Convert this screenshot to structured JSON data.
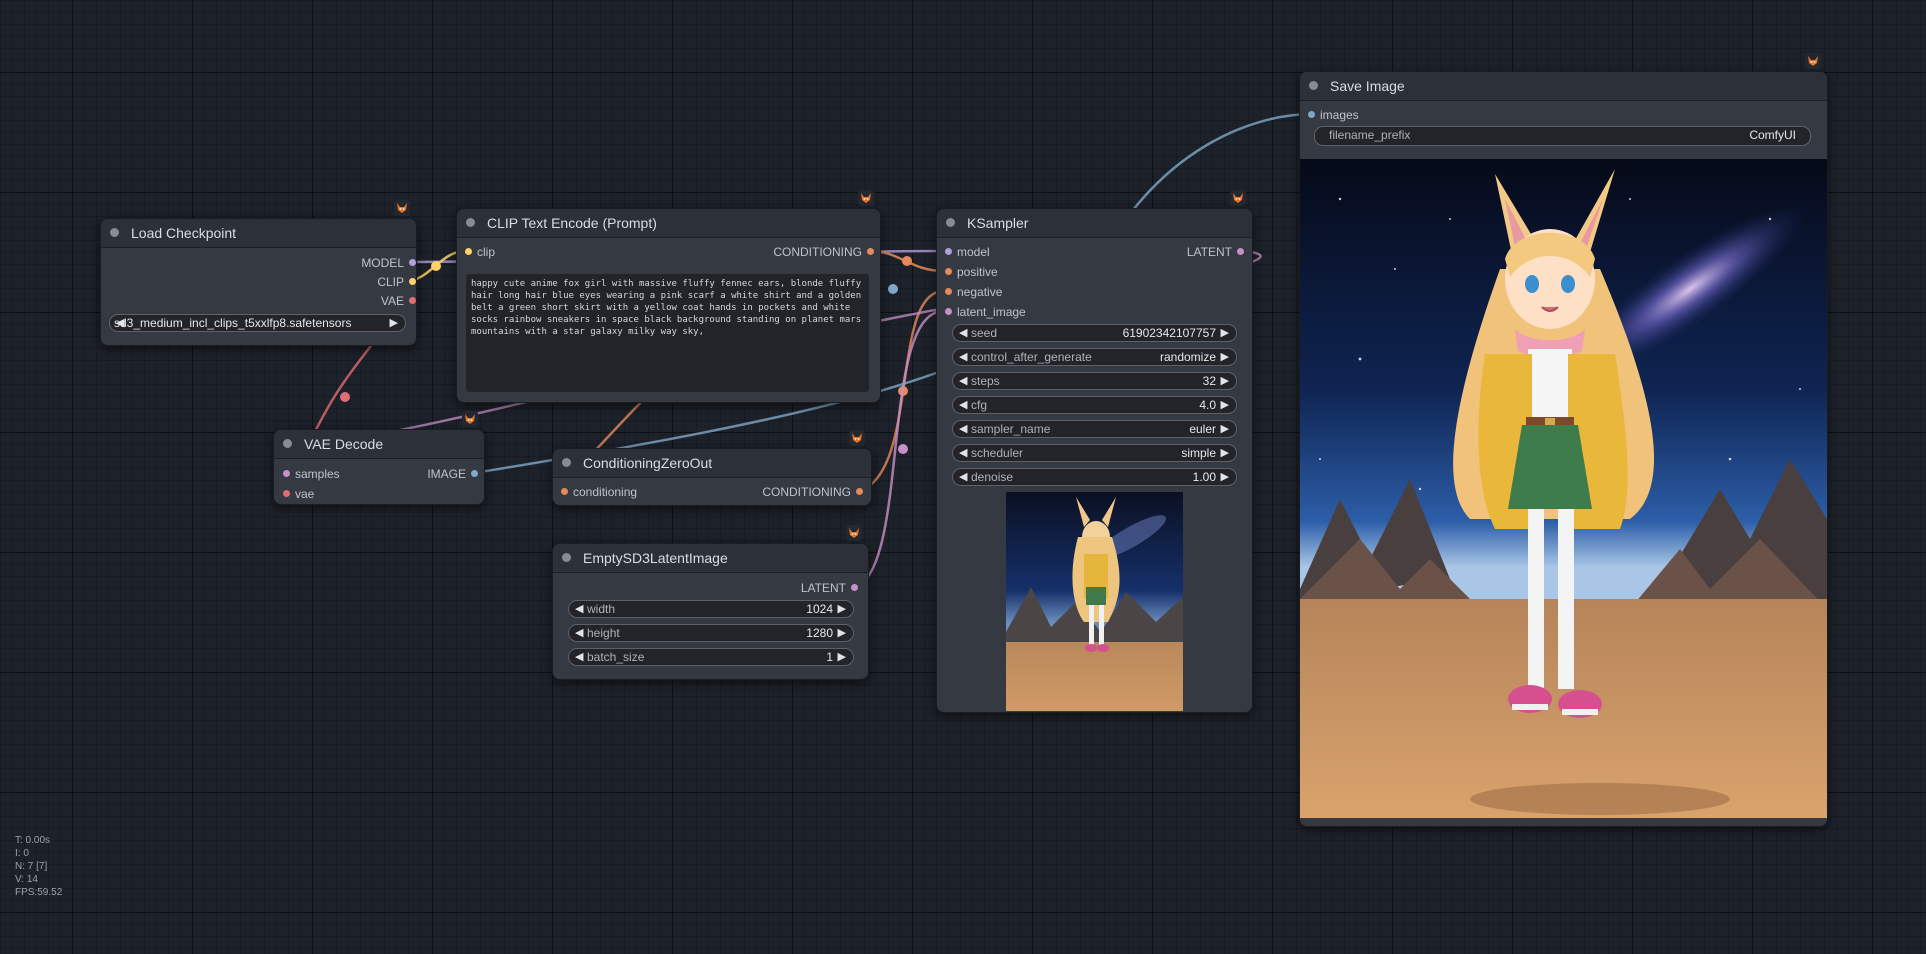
{
  "canvas": {
    "stats": {
      "time": "T: 0.00s",
      "iterations": "I: 0",
      "nodes": "N: 7 [7]",
      "vertices": "V: 14",
      "fps": "FPS:59.52"
    }
  },
  "colors": {
    "model": "#b39ddb",
    "clip": "#ffd166",
    "vae": "#e06c75",
    "conditioning": "#e58a5c",
    "latent": "#c890c8",
    "image": "#7fa9c9"
  },
  "nodes": {
    "load_checkpoint": {
      "title": "Load Checkpoint",
      "outputs": [
        "MODEL",
        "CLIP",
        "VAE"
      ],
      "ckpt_name": "sd3_medium_incl_clips_t5xxlfp8.safetensors"
    },
    "clip_text_encode": {
      "title": "CLIP Text Encode (Prompt)",
      "input": "clip",
      "output": "CONDITIONING",
      "text": "happy cute anime fox girl with massive fluffy fennec ears, blonde fluffy hair long hair blue eyes wearing a pink scarf a white shirt and a golden belt a green short skirt with a yellow coat hands in pockets and white socks rainbow sneakers in space black background standing on planet mars mountains with a star galaxy milky way sky,"
    },
    "vae_decode": {
      "title": "VAE Decode",
      "inputs": [
        "samples",
        "vae"
      ],
      "output": "IMAGE"
    },
    "conditioning_zero_out": {
      "title": "ConditioningZeroOut",
      "input": "conditioning",
      "output": "CONDITIONING"
    },
    "empty_latent": {
      "title": "EmptySD3LatentImage",
      "output": "LATENT",
      "widgets": [
        {
          "label": "width",
          "value": "1024"
        },
        {
          "label": "height",
          "value": "1280"
        },
        {
          "label": "batch_size",
          "value": "1"
        }
      ]
    },
    "ksampler": {
      "title": "KSampler",
      "inputs": [
        "model",
        "positive",
        "negative",
        "latent_image"
      ],
      "output": "LATENT",
      "widgets": [
        {
          "label": "seed",
          "value": "61902342107757"
        },
        {
          "label": "control_after_generate",
          "value": "randomize"
        },
        {
          "label": "steps",
          "value": "32"
        },
        {
          "label": "cfg",
          "value": "4.0"
        },
        {
          "label": "sampler_name",
          "value": "euler"
        },
        {
          "label": "scheduler",
          "value": "simple"
        },
        {
          "label": "denoise",
          "value": "1.00"
        }
      ]
    },
    "save_image": {
      "title": "Save Image",
      "input": "images",
      "filename_prefix_label": "filename_prefix",
      "filename_prefix_value": "ComfyUI"
    }
  }
}
